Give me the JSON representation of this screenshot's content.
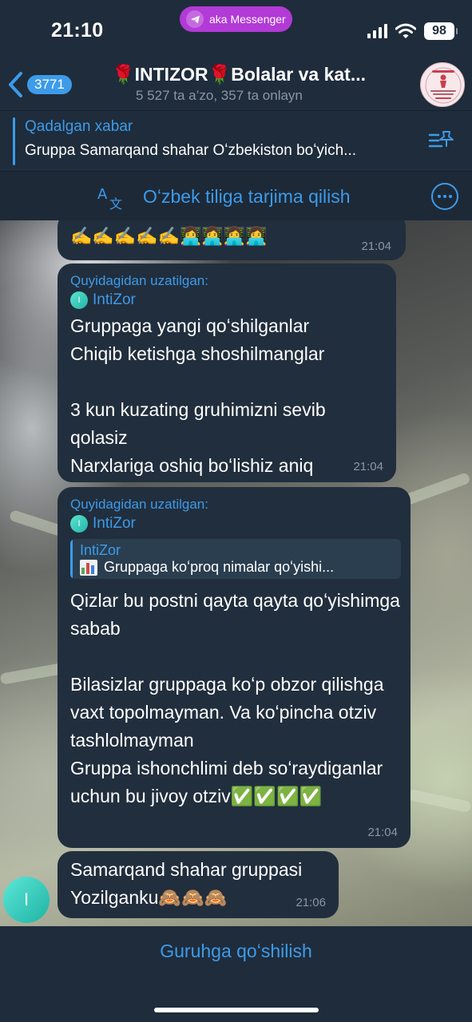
{
  "status_bar": {
    "time": "21:10",
    "messenger_pill": "aka Messenger",
    "battery": "98"
  },
  "header": {
    "unread_count": "3771",
    "title": "🌹INTIZOR🌹Bolalar va kat...",
    "subtitle": "5 527 ta a’zo, 357 ta onlayn"
  },
  "pinned": {
    "label": "Qadalgan xabar",
    "text": "Gruppa Samarqand shahar Oʻzbekiston boʻyich..."
  },
  "translate": {
    "label": "Oʻzbek tiliga tarjima qilish"
  },
  "messages": [
    {
      "text": "✍️✍️✍️✍️✍️👩‍💻👩‍💻👩‍💻👩‍💻",
      "time": "21:04"
    },
    {
      "forwarded_label": "Quyidagidan uzatilgan:",
      "author": "IntiZor",
      "author_initial": "I",
      "text": "Gruppaga yangi qoʻshilganlar\nChiqib ketishga shoshilmanglar\n\n3 kun kuzating gruhimizni sevib qolasiz\nNarxlariga oshiq boʻlishiz aniq",
      "time": "21:04"
    },
    {
      "forwarded_label": "Quyidagidan uzatilgan:",
      "author": "IntiZor",
      "author_initial": "I",
      "reply_author": "IntiZor",
      "reply_text": "Gruppaga koʻproq nimalar qoʻyishi...",
      "text": "Qizlar bu postni qayta qayta qoʻyishimga sabab\n\nBilasizlar gruppaga koʻp obzor qilishga vaxt topolmayman. Va koʻpincha otziv tashlolmayman\nGruppa ishonchlimi deb soʻraydiganlar uchun bu jivoy otziv✅✅✅✅",
      "time": "21:04"
    },
    {
      "text": "Samarqand shahar gruppasi\nYozilganku🙈🙈🙈",
      "time": "21:06",
      "sender_initial": "I"
    }
  ],
  "bottom": {
    "join_label": "Guruhga qoʻshilish"
  },
  "colors": {
    "accent": "#3d9be9",
    "bubble": "#212e3d",
    "header_bg": "#1f2c3b",
    "messenger_pill": "#b23ad6"
  }
}
